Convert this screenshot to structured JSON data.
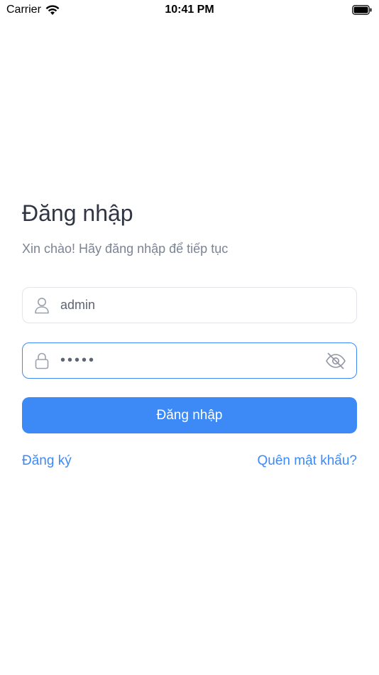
{
  "status_bar": {
    "carrier": "Carrier",
    "time": "10:41 PM",
    "wifi_icon": "wifi-icon",
    "battery_icon": "battery-icon"
  },
  "login": {
    "title": "Đăng nhập",
    "subtitle": "Xin chào! Hãy đăng nhập để tiếp tục",
    "username": {
      "value": "admin",
      "icon": "user-icon"
    },
    "password": {
      "value": "•••••",
      "icon": "lock-icon",
      "toggle_icon": "eye-off-icon"
    },
    "submit_label": "Đăng nhập",
    "register_label": "Đăng ký",
    "forgot_label": "Quên mật khẩu?"
  },
  "colors": {
    "accent": "#3d8af7",
    "title_text": "#2f3542",
    "muted_text": "#7b8394",
    "field_border": "#e2e5ea"
  }
}
